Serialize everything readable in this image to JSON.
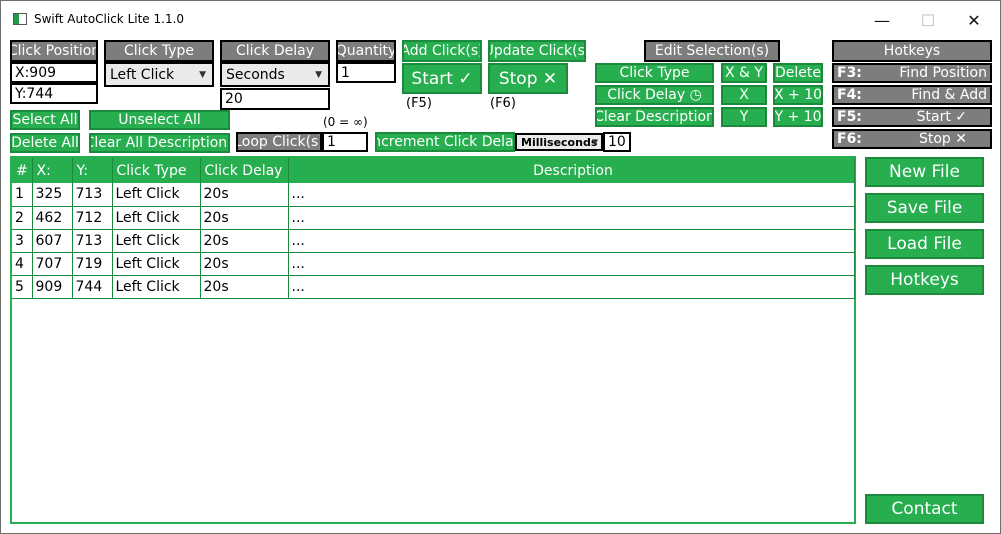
{
  "window": {
    "title": "Swift AutoClick Lite 1.1.0",
    "minimize": "—",
    "maximize": "☐",
    "close": "✕"
  },
  "position": {
    "header": "Click Position",
    "x": "X:909",
    "y": "Y:744"
  },
  "click_type": {
    "header": "Click Type",
    "value": "Left Click"
  },
  "click_delay": {
    "header": "Click Delay",
    "unit": "Seconds",
    "value": "20"
  },
  "quantity": {
    "header": "Quantity",
    "value": "1"
  },
  "actions": {
    "add": "Add Click(s)",
    "update": "Update Click(s)",
    "start": "Start ✓",
    "stop": "Stop ✕",
    "start_key": "(F5)",
    "stop_key": "(F6)"
  },
  "edit": {
    "header": "Edit Selection(s)",
    "click_type": "Click Type",
    "click_delay": "Click Delay ◷",
    "clear_desc": "Clear Description",
    "xy": "X & Y",
    "x": "X",
    "y": "Y",
    "delete": "Delete",
    "x10": "X + 10",
    "y10": "Y + 10"
  },
  "hotkeys": {
    "header": "Hotkeys",
    "items": [
      {
        "key": "F3:",
        "action": "Find Position"
      },
      {
        "key": "F4:",
        "action": "Find & Add"
      },
      {
        "key": "F5:",
        "action": "Start ✓"
      },
      {
        "key": "F6:",
        "action": "Stop ✕"
      }
    ]
  },
  "selection": {
    "select_all": "Select All",
    "unselect_all": "Unselect All",
    "delete_all": "Delete All",
    "clear_all_desc": "Clear All Descriptions"
  },
  "loop": {
    "label": "Loop Click(s)",
    "value": "1",
    "hint": "(0 = ∞)"
  },
  "increment": {
    "label": "Increment Click Delay",
    "unit": "Milliseconds",
    "value": "10"
  },
  "table": {
    "headers": [
      "#",
      "X:",
      "Y:",
      "Click Type",
      "Click Delay",
      "Description"
    ],
    "rows": [
      [
        "1",
        "325",
        "713",
        "Left Click",
        "20s",
        "..."
      ],
      [
        "2",
        "462",
        "712",
        "Left Click",
        "20s",
        "..."
      ],
      [
        "3",
        "607",
        "713",
        "Left Click",
        "20s",
        "..."
      ],
      [
        "4",
        "707",
        "719",
        "Left Click",
        "20s",
        "..."
      ],
      [
        "5",
        "909",
        "744",
        "Left Click",
        "20s",
        "..."
      ]
    ]
  },
  "file_panel": {
    "new": "New File",
    "save": "Save File",
    "load": "Load File",
    "hotkeys": "Hotkeys",
    "contact": "Contact"
  }
}
